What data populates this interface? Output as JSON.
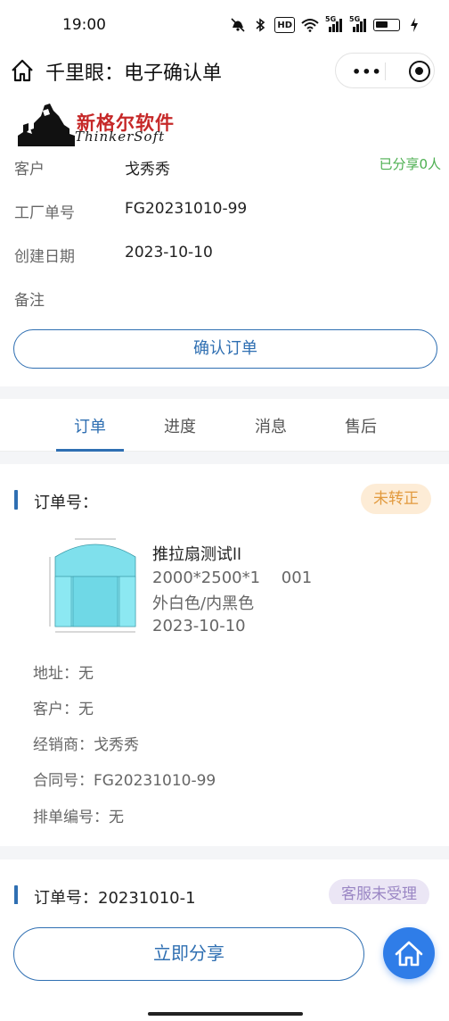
{
  "status_bar": {
    "time": "19:00",
    "icons": [
      "mute-icon",
      "bluetooth-icon",
      "hd-icon",
      "wifi-icon",
      "signal-5g-icon",
      "signal-5g-icon",
      "battery-icon",
      "charging-icon"
    ],
    "hd_text": "HD",
    "signal1_text": "5G",
    "signal2_text": "5G",
    "battery_level": 0.55
  },
  "navbar": {
    "title": "千里眼：电子确认单",
    "more_label": "•••"
  },
  "brand": {
    "name_cn": "新格尔软件",
    "name_en": "ThinkerSoft",
    "color": "#c62828"
  },
  "info": {
    "customer_label": "客户",
    "customer_value": "戈秀秀",
    "shared_text": "已分享0人",
    "factory_no_label": "工厂单号",
    "factory_no_value": "FG20231010-99",
    "created_label": "创建日期",
    "created_value": "2023-10-10",
    "remark_label": "备注",
    "remark_value": ""
  },
  "confirm_button": "确认订单",
  "tabs": [
    {
      "label": "订单",
      "active": true
    },
    {
      "label": "进度",
      "active": false
    },
    {
      "label": "消息",
      "active": false
    },
    {
      "label": "售后",
      "active": false
    }
  ],
  "orders": [
    {
      "order_no_label": "订单号：",
      "status": "未转正",
      "product_name": "推拉扇测试ll",
      "spec": "2000*2500*1　 001",
      "color": "外白色/内黑色",
      "date": "2023-10-10",
      "address": "地址：无",
      "customer": "客户：无",
      "dealer": "经销商：戈秀秀",
      "contract": "合同号：FG20231010-99",
      "schedule": "排单编号：无"
    },
    {
      "order_no_label": "订单号：20231010-1",
      "status": "客服未受理"
    }
  ],
  "share_button": "立即分享",
  "colors": {
    "primary": "#2f6fb2",
    "fab": "#2f7de8",
    "shared_green": "#4caf50",
    "badge_orange": "#e29a3e",
    "badge_purple": "#9a86c4"
  }
}
